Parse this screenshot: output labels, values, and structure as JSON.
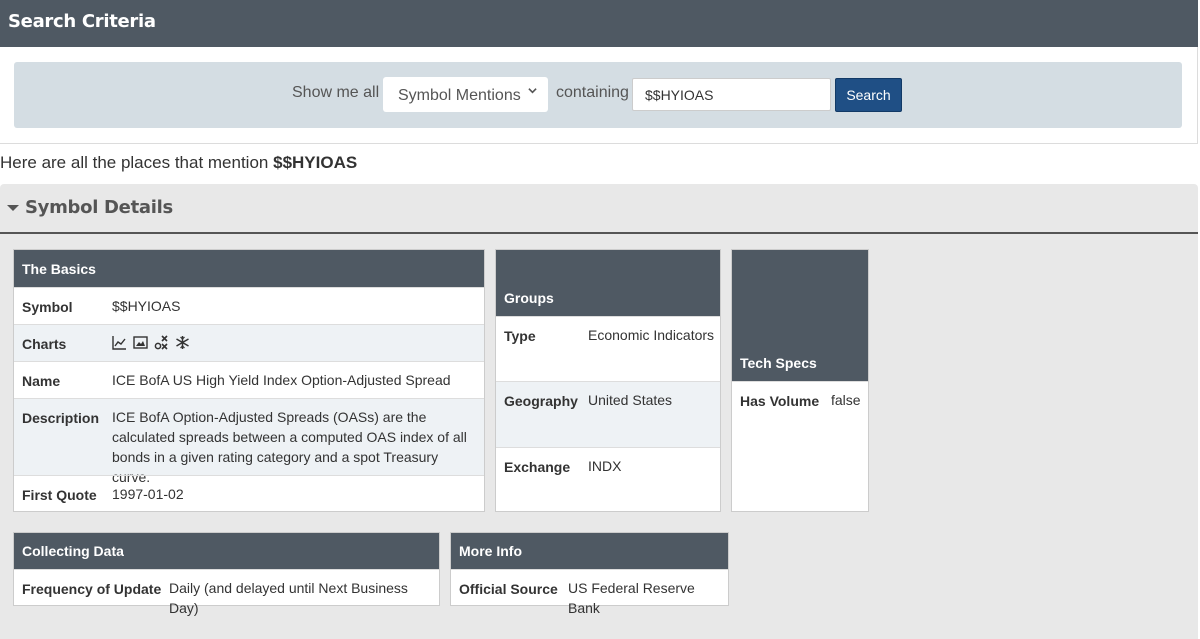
{
  "header": {
    "title": "Search Criteria"
  },
  "search": {
    "show_label": "Show me all",
    "select_value": "Symbol Mentions",
    "containing_label": "containing",
    "input_value": "$$HYIOAS",
    "button_label": "Search"
  },
  "mention": {
    "prefix": "Here are all the places that mention",
    "symbol": "$$HYIOAS"
  },
  "details": {
    "title": "Symbol Details"
  },
  "basics": {
    "title": "The Basics",
    "symbol_label": "Symbol",
    "symbol_value": "$$HYIOAS",
    "charts_label": "Charts",
    "chart_icons": [
      "line-chart-icon",
      "image-chart-icon",
      "pnf-chart-icon",
      "seasonality-chart-icon"
    ],
    "name_label": "Name",
    "name_value": "ICE BofA US High Yield Index Option-Adjusted Spread",
    "desc_label": "Description",
    "desc_value": "ICE BofA Option-Adjusted Spreads (OASs) are the calculated spreads between a computed OAS index of all bonds in a given rating category and a spot Treasury curve.",
    "first_label": "First Quote",
    "first_value": "1997-01-02"
  },
  "groups": {
    "title": "Groups",
    "type_label": "Type",
    "type_value": "Economic Indicators",
    "geo_label": "Geography",
    "geo_value": "United States",
    "exch_label": "Exchange",
    "exch_value": "INDX"
  },
  "tech": {
    "title": "Tech Specs",
    "vol_label": "Has Volume",
    "vol_value": "false"
  },
  "collecting": {
    "title": "Collecting Data",
    "freq_label": "Frequency of Update",
    "freq_value": "Daily (and delayed until Next Business Day)"
  },
  "more": {
    "title": "More Info",
    "src_label": "Official Source",
    "src_value": "US Federal Reserve Bank"
  },
  "colors": {
    "header": "#4f5963",
    "button": "#1f4f85",
    "criteria_bg": "#d4dde3"
  }
}
